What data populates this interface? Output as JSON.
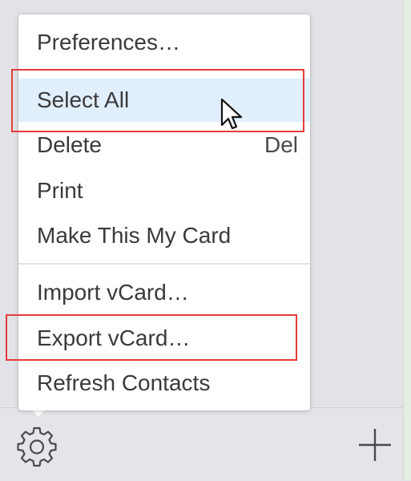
{
  "menu": {
    "items": [
      {
        "label": "Preferences…",
        "shortcut": ""
      },
      {
        "label": "Select All",
        "shortcut": ""
      },
      {
        "label": "Delete",
        "shortcut": "Del"
      },
      {
        "label": "Print",
        "shortcut": ""
      },
      {
        "label": "Make This My Card",
        "shortcut": ""
      },
      {
        "label": "Import vCard…",
        "shortcut": ""
      },
      {
        "label": "Export vCard…",
        "shortcut": ""
      },
      {
        "label": "Refresh Contacts",
        "shortcut": ""
      }
    ],
    "highlighted_item": "Select All"
  },
  "toolbar": {
    "left_icon": "gear-icon",
    "right_icon": "plus-icon"
  },
  "annotations": {
    "highlight_color": "#e23c3a",
    "boxed_items": [
      "Select All",
      "Export vCard…"
    ]
  },
  "colors": {
    "menu_bg": "#ffffff",
    "selection_bg": "#e1eefb",
    "text": "#3a3a3c",
    "toolbar_bg": "#e4e5e8"
  }
}
